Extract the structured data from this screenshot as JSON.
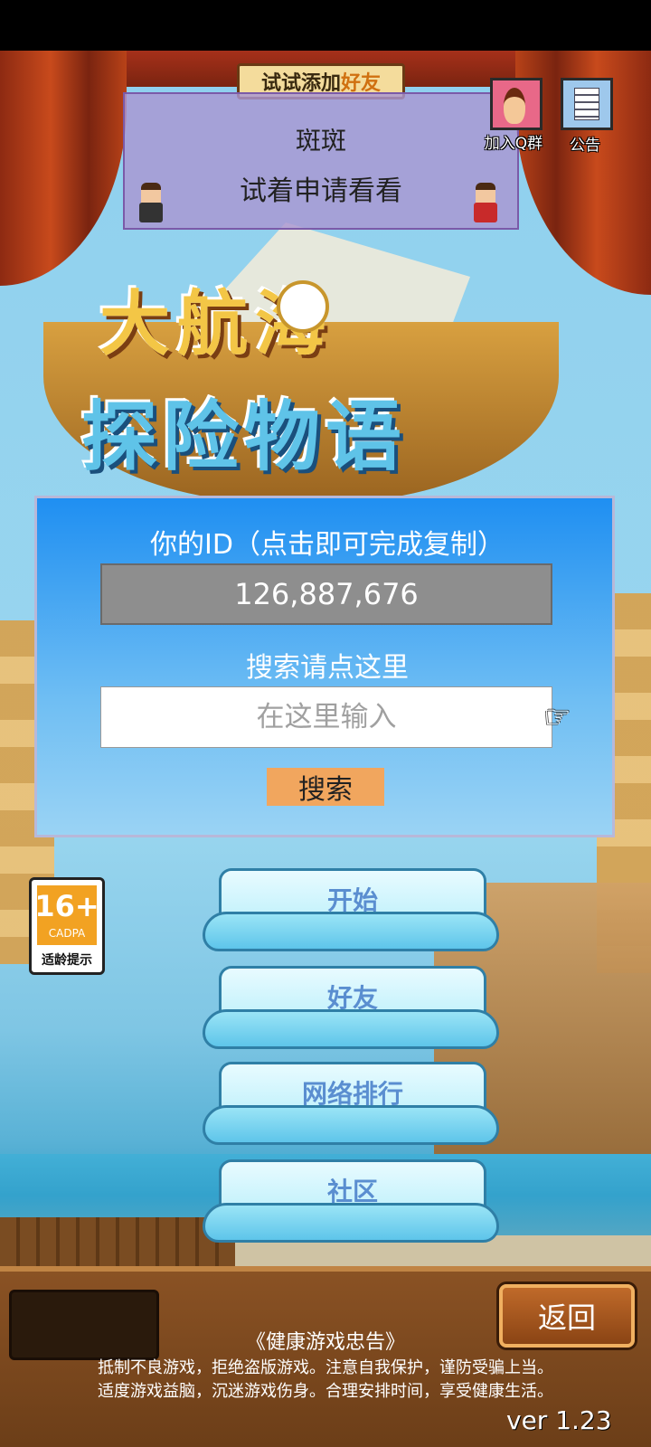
{
  "banner": {
    "prefix": "试试添加",
    "highlight": "好友"
  },
  "toast": {
    "name": "斑斑",
    "message": "试着申请看看"
  },
  "top_icons": {
    "qq_group": "加入Q群",
    "notice": "公告"
  },
  "logo": {
    "line1": "大航海",
    "line2": "探险物语"
  },
  "id_panel": {
    "title": "你的ID（点击即可完成复制）",
    "id_value": "126,887,676",
    "search_title": "搜索请点这里",
    "search_placeholder": "在这里输入",
    "search_button": "搜索"
  },
  "age_badge": {
    "age": "16+",
    "org": "CADPA",
    "tip": "适龄提示"
  },
  "menu": [
    {
      "label": "开始"
    },
    {
      "label": "好友"
    },
    {
      "label": "网络排行"
    },
    {
      "label": "社区"
    }
  ],
  "footer": {
    "back_button": "返回",
    "advisory_title": "《健康游戏忠告》",
    "advisory_line1": "抵制不良游戏，拒绝盗版游戏。注意自我保护，谨防受骗上当。",
    "advisory_line2": "适度游戏益脑，沉迷游戏伤身。合理安排时间，享受健康生活。",
    "version": "ver 1.23"
  },
  "colors": {
    "panel_top": "#1f8ff2",
    "search_button": "#f1a65e",
    "id_box": "#8e8e8e",
    "toast_bg": "#aa96d2"
  }
}
